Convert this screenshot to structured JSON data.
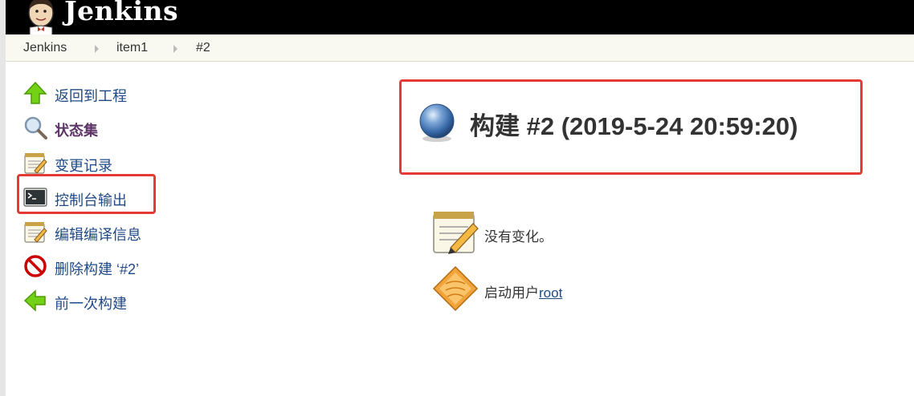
{
  "header": {
    "brand": "Jenkins"
  },
  "breadcrumb": {
    "items": [
      "Jenkins",
      "item1",
      "#2"
    ]
  },
  "sidebar": {
    "items": [
      {
        "label": "返回到工程",
        "icon": "up-arrow-icon"
      },
      {
        "label": "状态集",
        "icon": "search-icon",
        "active": true
      },
      {
        "label": "变更记录",
        "icon": "notepad-icon"
      },
      {
        "label": "控制台输出",
        "icon": "terminal-icon"
      },
      {
        "label": "编辑编译信息",
        "icon": "notepad-edit-icon"
      },
      {
        "label": "删除构建 ‘#2’",
        "icon": "no-entry-icon"
      },
      {
        "label": "前一次构建",
        "icon": "left-arrow-icon"
      }
    ]
  },
  "main": {
    "title": "构建 #2 (2019-5-24 20:59:20)",
    "changes_text": "没有变化。",
    "started_by_prefix": "启动用户",
    "started_by_user": "root"
  },
  "colors": {
    "header_bg": "#000000",
    "breadcrumb_bg": "#f9f9f2",
    "link": "#204a87",
    "highlight": "#e53935",
    "status_ball": "#3465a4"
  }
}
